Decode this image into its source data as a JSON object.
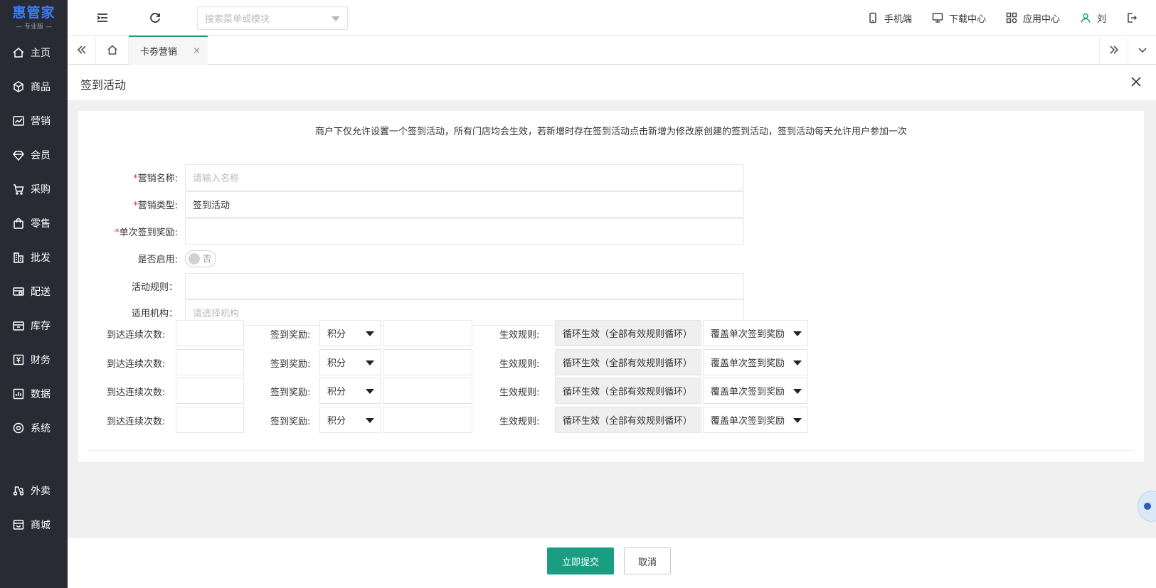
{
  "logo": {
    "name": "惠管家",
    "sub": "— 专业版 —"
  },
  "sidebar": {
    "items": [
      {
        "label": "主页",
        "icon": "home-icon"
      },
      {
        "label": "商品",
        "icon": "cube-icon"
      },
      {
        "label": "营销",
        "icon": "chart-icon"
      },
      {
        "label": "会员",
        "icon": "diamond-icon"
      },
      {
        "label": "采购",
        "icon": "cart-icon"
      },
      {
        "label": "零售",
        "icon": "bag-icon"
      },
      {
        "label": "批发",
        "icon": "building-icon"
      },
      {
        "label": "配送",
        "icon": "truck-icon"
      },
      {
        "label": "库存",
        "icon": "warehouse-icon"
      },
      {
        "label": "财务",
        "icon": "yen-icon"
      },
      {
        "label": "数据",
        "icon": "bar-chart-icon"
      },
      {
        "label": "系统",
        "icon": "settings-icon"
      }
    ],
    "extra": [
      {
        "label": "外卖",
        "icon": "delivery-icon"
      },
      {
        "label": "商城",
        "icon": "store-icon"
      }
    ]
  },
  "topbar": {
    "search_placeholder": "搜索菜单或模块",
    "links": {
      "mobile": "手机端",
      "download": "下载中心",
      "apps": "应用中心",
      "user": "刘"
    }
  },
  "tabs": {
    "active": "卡劵营销",
    "close": "×"
  },
  "dialog": {
    "title": "签到活动",
    "notice": "商户下仅允许设置一个签到活动，所有门店均会生效，若新增时存在签到活动点击新增为修改原创建的签到活动，签到活动每天允许用户参加一次",
    "form": {
      "name_label": "营销名称:",
      "name_placeholder": "请输入名称",
      "type_label": "营销类型:",
      "type_value": "签到活动",
      "reward_label": "单次签到奖励:",
      "enable_label": "是否启用:",
      "enable_state": "否",
      "rules_label": "活动规则：",
      "org_label": "适用机构：",
      "org_placeholder": "请选择机构"
    },
    "reward_rows": [
      {
        "days_label": "到达连续次数:",
        "reward_label": "签到奖励:",
        "reward_type": "积分",
        "effect_label": "生效规则:",
        "effect_value": "循环生效（全部有效规则循环）",
        "cover_value": "覆盖单次签到奖励"
      },
      {
        "days_label": "到达连续次数:",
        "reward_label": "签到奖励:",
        "reward_type": "积分",
        "effect_label": "生效规则:",
        "effect_value": "循环生效（全部有效规则循环）",
        "cover_value": "覆盖单次签到奖励"
      },
      {
        "days_label": "到达连续次数:",
        "reward_label": "签到奖励:",
        "reward_type": "积分",
        "effect_label": "生效规则:",
        "effect_value": "循环生效（全部有效规则循环）",
        "cover_value": "覆盖单次签到奖励"
      },
      {
        "days_label": "到达连续次数:",
        "reward_label": "签到奖励:",
        "reward_type": "积分",
        "effect_label": "生效规则:",
        "effect_value": "循环生效（全部有效规则循环）",
        "cover_value": "覆盖单次签到奖励"
      }
    ]
  },
  "footer": {
    "submit": "立即提交",
    "cancel": "取消"
  },
  "colors": {
    "primary": "#1a9e83",
    "sidebar_bg": "#282b33",
    "logo": "#3a7bff",
    "required": "#e4393c"
  }
}
